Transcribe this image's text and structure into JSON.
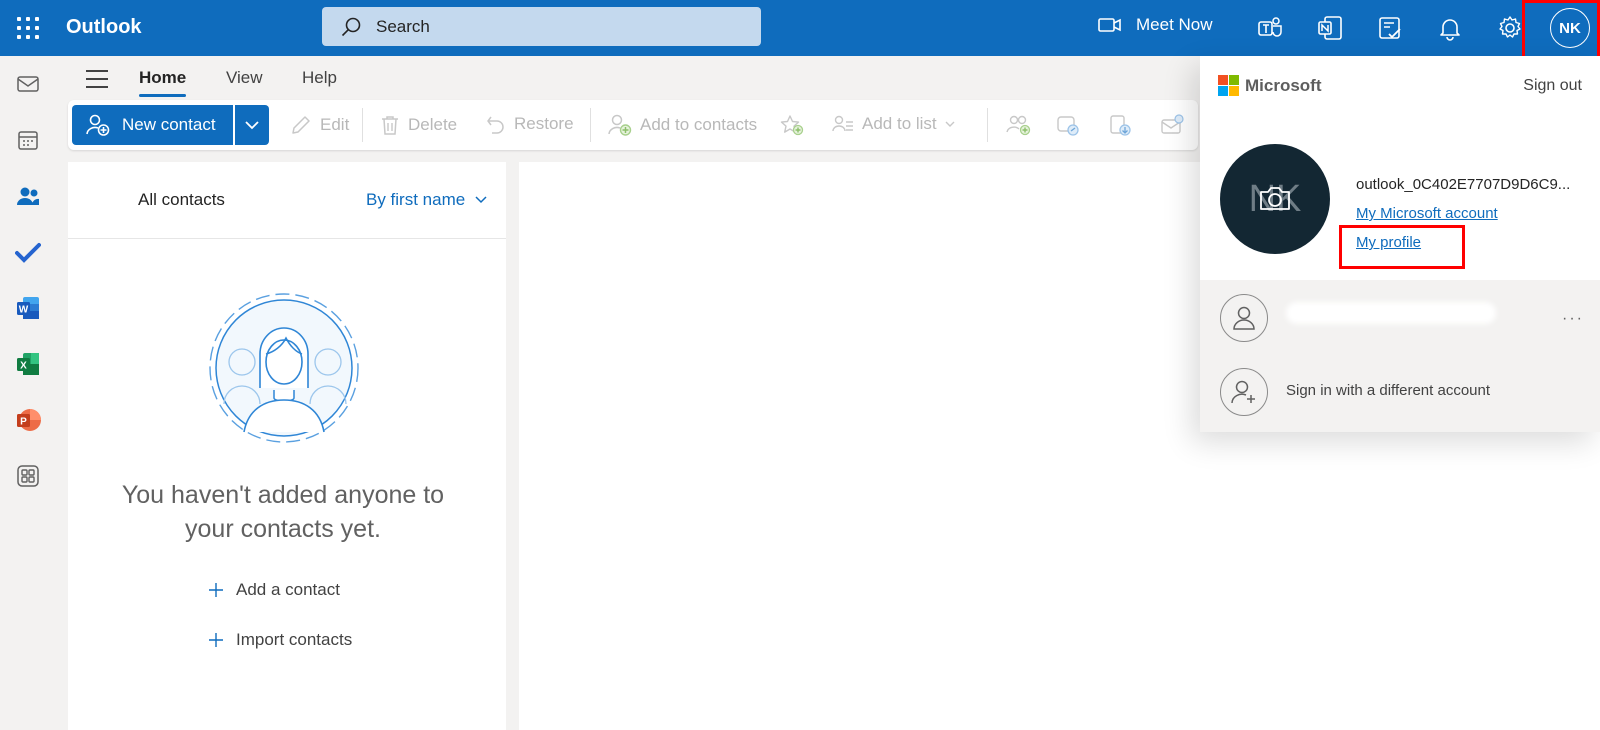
{
  "topbar": {
    "app_name": "Outlook",
    "search_placeholder": "Search",
    "meet_now": "Meet Now",
    "avatar_initials": "NK"
  },
  "tabs": [
    "Home",
    "View",
    "Help"
  ],
  "ribbon": {
    "new_contact": "New contact",
    "edit": "Edit",
    "delete": "Delete",
    "restore": "Restore",
    "add_to_contacts": "Add to contacts",
    "add_to_list": "Add to list"
  },
  "list": {
    "title": "All contacts",
    "sort": "By first name",
    "empty_line1": "You haven't added anyone to",
    "empty_line2": "your contacts yet.",
    "add_contact": "Add a contact",
    "import_contacts": "Import contacts"
  },
  "account_panel": {
    "brand": "Microsoft",
    "sign_out": "Sign out",
    "avatar_initials": "NK",
    "account_name": "outlook_0C402E7707D9D6C9...",
    "my_account": "My Microsoft account",
    "my_profile": "My profile",
    "sign_in_different": "Sign in with a different account"
  },
  "colors": {
    "brand_blue": "#0f6cbd",
    "highlight_red": "#ff0000"
  }
}
